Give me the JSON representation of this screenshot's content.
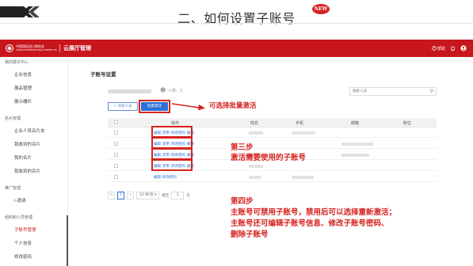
{
  "slide": {
    "title": "二、如何设置子账号",
    "badge": "NEW"
  },
  "topbar": {
    "logo_text_line1": "中国国际进口博览会",
    "logo_text_line2": "CHINA INTERNATIONAL IMPORT EXPO",
    "app_name": "云展厅管理",
    "help_label": "帮助"
  },
  "sidebar": {
    "groups": [
      {
        "label": "我的展示中心",
        "items": [
          "企业信息",
          "展品管理",
          "展示栅栏"
        ]
      },
      {
        "label": "名片管理",
        "items": [
          "企业人员名片夹",
          "我收到的名片",
          "我的名片",
          "我收到的名片"
        ]
      },
      {
        "label": "推广管理",
        "items": [
          "i-邀请"
        ]
      },
      {
        "label": "组织和人员管理",
        "items": [
          "子账号管理",
          "个人信息",
          "修改密码"
        ]
      }
    ],
    "active_item": "子账号管理"
  },
  "main": {
    "page_title": "子账号设置",
    "count_label": "人数：3",
    "search_placeholder": "搜索人员",
    "add_button": "+ 添加人员",
    "batch_button": "批量激活",
    "table_headers": [
      "操作",
      "姓名",
      "手机",
      "邮箱",
      "职位"
    ],
    "row_ops": [
      [
        "编辑",
        "禁用",
        "修改密码",
        "删除"
      ],
      [
        "编辑",
        "禁用",
        "修改密码",
        "删除"
      ],
      [
        "编辑",
        "禁用",
        "修改密码",
        "删除"
      ],
      [
        "编辑",
        "禁用",
        "修改密码",
        "删除"
      ],
      [
        "编辑",
        "修改密码"
      ]
    ],
    "pagination": {
      "prev": "<",
      "current": "1",
      "next": ">",
      "page_size": "10 条/页",
      "jump_label": "跳至",
      "jump_value": "1",
      "page_unit": "页"
    }
  },
  "annotations": {
    "batch_note": "可选择批量激活",
    "step3_title": "第三步",
    "step3_text": "激活需要使用的子账号",
    "step4_title": "第四步",
    "step4_line1": "主账号可禁用子账号，禁用后可以选择重新激活；",
    "step4_line2": "主账号还可编辑子账号信息、修改子账号密码、",
    "step4_line3": "删除子账号"
  },
  "colors": {
    "brand_red": "#c8161d",
    "annotation_red": "#d6231f",
    "primary_blue": "#2d6fd6"
  },
  "icons": [
    "chevron-decor-icon",
    "new-badge-icon",
    "help-icon",
    "bell-icon",
    "user-circle-icon",
    "user-icon",
    "search-icon"
  ]
}
